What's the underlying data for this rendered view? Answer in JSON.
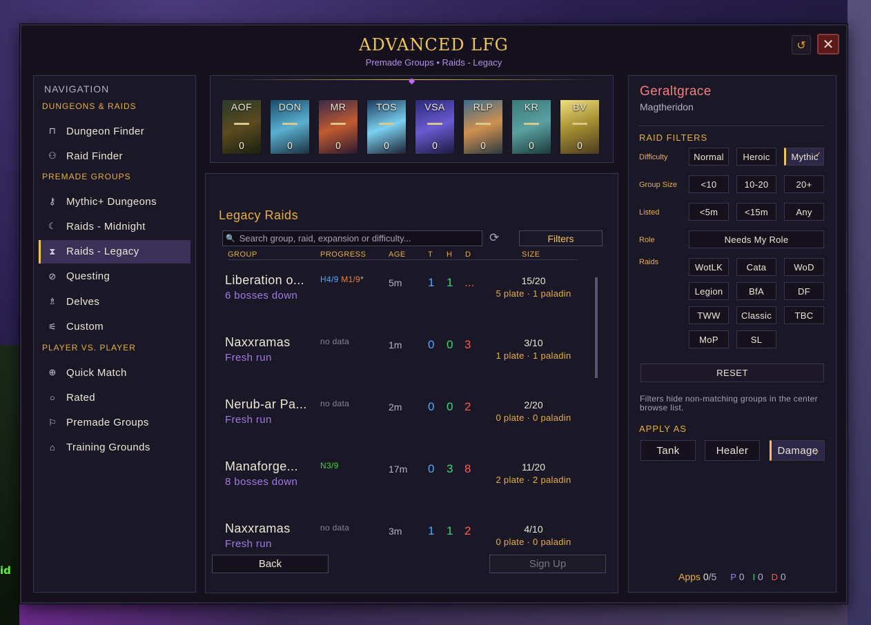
{
  "window": {
    "title": "ADVANCED LFG",
    "subtitle": "Premade Groups • Raids - Legacy",
    "side_text": "id"
  },
  "nav": {
    "heading": "NAVIGATION",
    "sections": [
      {
        "label": "DUNGEONS & RAIDS",
        "items": [
          {
            "label": "Dungeon Finder",
            "icon": "door-icon"
          },
          {
            "label": "Raid Finder",
            "icon": "users-icon"
          }
        ]
      },
      {
        "label": "PREMADE GROUPS",
        "items": [
          {
            "label": "Mythic+ Dungeons",
            "icon": "key-icon"
          },
          {
            "label": "Raids - Midnight",
            "icon": "moon-icon"
          },
          {
            "label": "Raids - Legacy",
            "icon": "hourglass-icon",
            "active": true
          },
          {
            "label": "Questing",
            "icon": "compass-icon"
          },
          {
            "label": "Delves",
            "icon": "lantern-icon"
          },
          {
            "label": "Custom",
            "icon": "sliders-icon"
          }
        ]
      },
      {
        "label": "PLAYER VS. PLAYER",
        "items": [
          {
            "label": "Quick Match",
            "icon": "crosshair-icon"
          },
          {
            "label": "Rated",
            "icon": "circle-icon"
          },
          {
            "label": "Premade Groups",
            "icon": "flag-icon"
          },
          {
            "label": "Training Grounds",
            "icon": "robot-icon"
          }
        ]
      }
    ]
  },
  "raids": [
    {
      "abbr": "AOF",
      "count": "0",
      "colors": [
        "#2a3a2a",
        "#5a4a20",
        "#1a2010"
      ]
    },
    {
      "abbr": "DON",
      "count": "0",
      "colors": [
        "#1a4a6a",
        "#5ab0d0",
        "#1a3040"
      ]
    },
    {
      "abbr": "MR",
      "count": "0",
      "colors": [
        "#3a2a4a",
        "#c05a30",
        "#2a1a30"
      ]
    },
    {
      "abbr": "TOS",
      "count": "0",
      "colors": [
        "#1a3a5a",
        "#7ad0f0",
        "#1a2030"
      ]
    },
    {
      "abbr": "VSA",
      "count": "0",
      "colors": [
        "#2a2a7a",
        "#6a5ad0",
        "#1a1a40"
      ]
    },
    {
      "abbr": "RLP",
      "count": "0",
      "colors": [
        "#3a6a8a",
        "#d09050",
        "#2a3a40"
      ]
    },
    {
      "abbr": "KR",
      "count": "0",
      "colors": [
        "#3a7a7a",
        "#5aa0a0",
        "#1a3a3a"
      ]
    },
    {
      "abbr": "BV",
      "count": "0",
      "colors": [
        "#f0e080",
        "#a08a30",
        "#4a3a20"
      ]
    }
  ],
  "center": {
    "title": "Legacy Raids",
    "search_placeholder": "Search group, raid, expansion or difficulty...",
    "filters_label": "Filters",
    "columns": {
      "group": "GROUP",
      "progress": "PROGRESS",
      "age": "AGE",
      "t": "T",
      "h": "H",
      "d": "D",
      "size": "SIZE"
    },
    "back_label": "Back",
    "signup_label": "Sign Up"
  },
  "groups": [
    {
      "name": "Liberation o...",
      "desc": "6 bosses down",
      "progress": [
        {
          "text": "H4/9",
          "color": "#50a8ff"
        },
        {
          "text": " M1/9",
          "color": "#f08030"
        },
        {
          "text": "*",
          "color": "#b8b0c8"
        }
      ],
      "age": "5m",
      "t": "1",
      "h": "1",
      "d": "...",
      "size": "15/20",
      "comp": "5 plate · 1 paladin"
    },
    {
      "name": "Naxxramas",
      "desc": "Fresh run",
      "progress": [
        {
          "text": "no data",
          "color": "#8a8498"
        }
      ],
      "age": "1m",
      "t": "0",
      "h": "0",
      "d": "3",
      "size": "3/10",
      "comp": "1 plate · 1 paladin"
    },
    {
      "name": "Nerub-ar Pa...",
      "desc": "Fresh run",
      "progress": [
        {
          "text": "no data",
          "color": "#8a8498"
        }
      ],
      "age": "2m",
      "t": "0",
      "h": "0",
      "d": "2",
      "size": "2/20",
      "comp": "0 plate · 0 paladin"
    },
    {
      "name": "Manaforge...",
      "desc": "8 bosses down",
      "progress": [
        {
          "text": "N3/9",
          "color": "#3ad83a"
        }
      ],
      "age": "17m",
      "t": "0",
      "h": "3",
      "d": "8",
      "size": "11/20",
      "comp": "2 plate · 2 paladin"
    },
    {
      "name": "Naxxramas",
      "desc": "Fresh run",
      "progress": [
        {
          "text": "no data",
          "color": "#8a8498"
        }
      ],
      "age": "3m",
      "t": "1",
      "h": "1",
      "d": "2",
      "size": "4/10",
      "comp": "0 plate · 0 paladin"
    }
  ],
  "right": {
    "char_name": "Geraltgrace",
    "realm": "Magtheridon",
    "raid_filters": "RAID FILTERS",
    "labels": {
      "difficulty": "Difficulty",
      "group_size": "Group Size",
      "listed": "Listed",
      "role": "Role",
      "raids": "Raids"
    },
    "difficulty": [
      {
        "label": "Normal"
      },
      {
        "label": "Heroic"
      },
      {
        "label": "Mythic",
        "selected": true
      }
    ],
    "group_size": [
      {
        "label": "<10"
      },
      {
        "label": "10-20"
      },
      {
        "label": "20+"
      }
    ],
    "listed": [
      {
        "label": "<5m"
      },
      {
        "label": "<15m"
      },
      {
        "label": "Any"
      }
    ],
    "role_label": "Needs My Role",
    "raid_buttons": [
      "WotLK",
      "Cata",
      "WoD",
      "Legion",
      "BfA",
      "DF",
      "TWW",
      "Classic",
      "TBC",
      "MoP",
      "SL"
    ],
    "reset_label": "RESET",
    "note": "Filters hide non-matching groups in the center browse list.",
    "apply_as": "APPLY AS",
    "roles": [
      {
        "label": "Tank"
      },
      {
        "label": "Healer"
      },
      {
        "label": "Damage",
        "selected": true
      }
    ],
    "apps": {
      "label": "Apps",
      "current": "0",
      "max": "/5",
      "p": "P",
      "pn": "0",
      "i": "I",
      "in": "0",
      "d": "D",
      "dn": "0"
    }
  }
}
